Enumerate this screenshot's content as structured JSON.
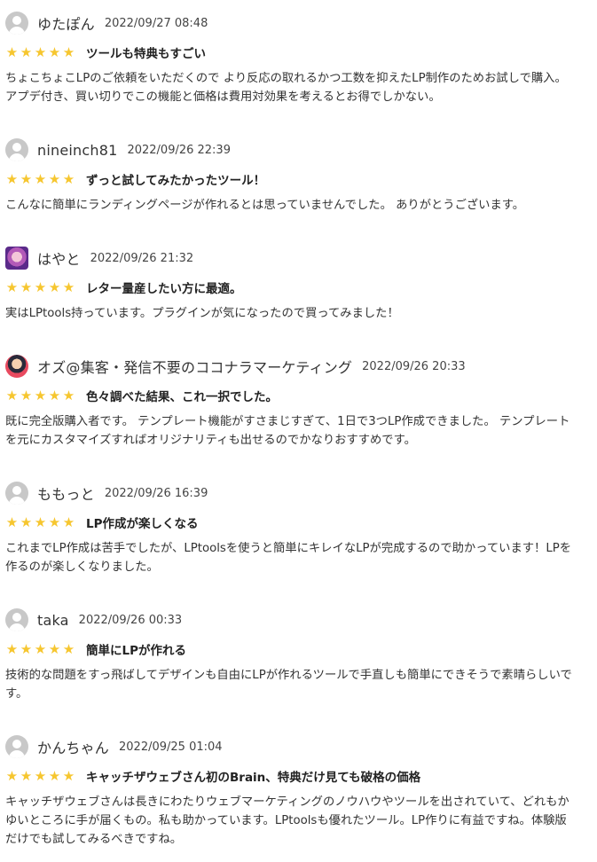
{
  "reviews": [
    {
      "author": "ゆたぽん",
      "date": "2022/09/27 08:48",
      "rating": 5,
      "avatar": "default-avatar",
      "title": "ツールも特典もすごい",
      "body": "ちょこちょこLPのご依頼をいただくので より反応の取れるかつ工数を抑えたLP制作のためお試しで購入。 アプデ付き、買い切りでこの機能と価格は費用対効果を考えるとお得でしかない。"
    },
    {
      "author": "nineinch81",
      "date": "2022/09/26 22:39",
      "rating": 5,
      "avatar": "default-avatar",
      "title": "ずっと試してみたかったツール！",
      "body": "こんなに簡単にランディングページが作れるとは思っていませんでした。 ありがとうございます。"
    },
    {
      "author": "はやと",
      "date": "2022/09/26 21:32",
      "rating": 5,
      "avatar": "anime-avatar",
      "title": "レター量産したい方に最適。",
      "body": "実はLPtools持っています。プラグインが気になったので買ってみました！"
    },
    {
      "author": "オズ@集客・発信不要のココナラマーケティング",
      "date": "2022/09/26 20:33",
      "rating": 5,
      "avatar": "character-avatar",
      "title": "色々調べた結果、これ一択でした。",
      "body": "既に完全版購入者です。 テンプレート機能がすさまじすぎて、1日で3つLP作成できました。 テンプレートを元にカスタマイズすればオリジナリティも出せるのでかなりおすすめです。"
    },
    {
      "author": "ももっと",
      "date": "2022/09/26 16:39",
      "rating": 5,
      "avatar": "default-avatar",
      "title": "LP作成が楽しくなる",
      "body": "これまでLP作成は苦手でしたが、LPtoolsを使うと簡単にキレイなLPが完成するので助かっています！LPを作るのが楽しくなりました。"
    },
    {
      "author": "taka",
      "date": "2022/09/26 00:33",
      "rating": 5,
      "avatar": "default-avatar",
      "title": "簡単にLPが作れる",
      "body": "技術的な問題をすっ飛ばしてデザインも自由にLPが作れるツールで手直しも簡単にできそうで素晴らしいです。"
    },
    {
      "author": "かんちゃん",
      "date": "2022/09/25 01:04",
      "rating": 5,
      "avatar": "default-avatar",
      "title": "キャッチザウェブさん初のBrain、特典だけ見ても破格の価格",
      "body": "キャッチザウェブさんは長きにわたりウェブマーケティングのノウハウやツールを出されていて、どれもかゆいところに手が届くもの。私も助かっています。LPtoolsも優れたツール。LP作りに有益ですね。体験版だけでも試してみるべきですね。"
    }
  ],
  "colors": {
    "star": "#f6c62f",
    "avatar_default": "#c8c8c8",
    "text": "#333333"
  }
}
